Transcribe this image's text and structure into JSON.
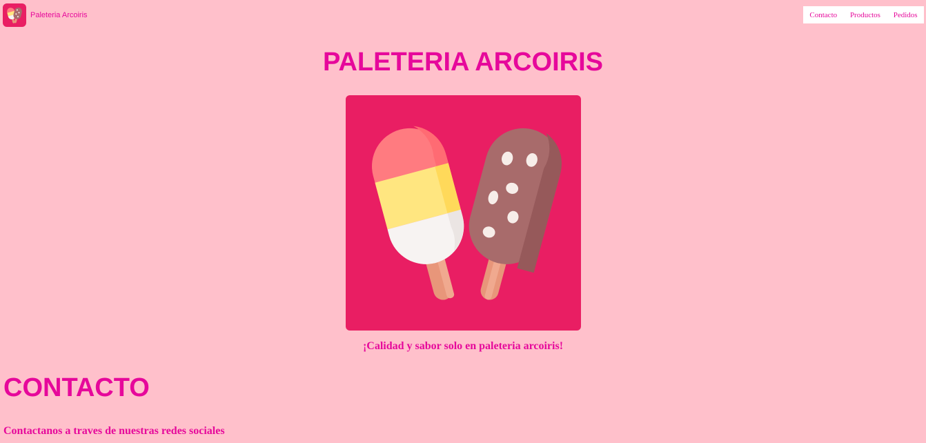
{
  "header": {
    "brand_name": "Paleteria Arcoiris",
    "logo_icon": "popsicle-logo-icon",
    "nav": [
      {
        "label": "Contacto"
      },
      {
        "label": "Productos"
      },
      {
        "label": "Pedidos"
      }
    ]
  },
  "hero": {
    "title": "PALETERIA ARCOIRIS",
    "image_icon": "popsicles-illustration",
    "tagline": "¡Calidad y sabor solo en paleteria arcoiris!"
  },
  "contact": {
    "title": "CONTACTO",
    "text": "Contactanos a traves de nuestras redes sociales"
  },
  "colors": {
    "background": "#ffc0cb",
    "accent": "#e6089b",
    "image_bg": "#e91e63"
  }
}
